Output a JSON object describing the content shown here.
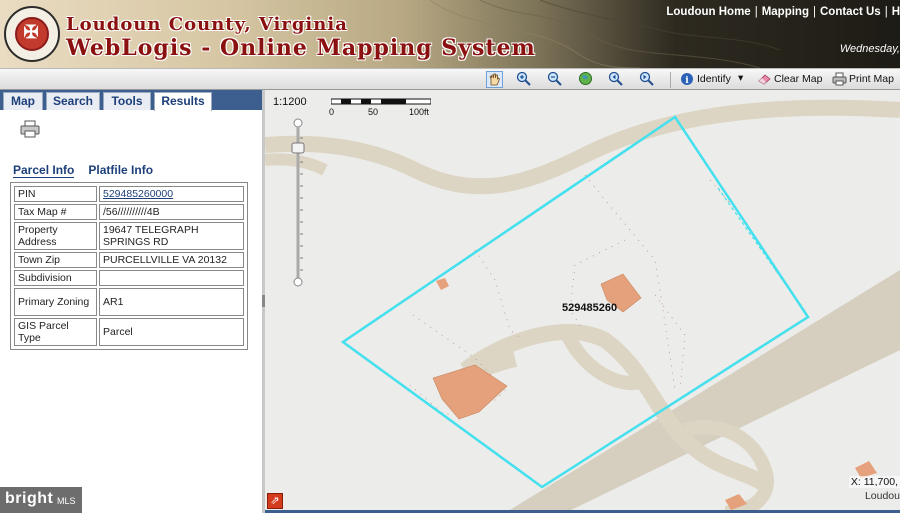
{
  "header": {
    "title_line1": "Loudoun County, Virginia",
    "title_line2": "WebLogis - Online Mapping System",
    "links": [
      "Loudoun Home",
      "Mapping",
      "Contact Us",
      "H"
    ],
    "date_text": "Wednesday, "
  },
  "toolbar": {
    "tools": [
      "pan-icon",
      "zoom-in-icon",
      "zoom-out-icon",
      "full-extent-icon",
      "zoom-previous-icon",
      "zoom-next-icon"
    ],
    "identify_label": "Identify",
    "clear_map_label": "Clear Map",
    "print_map_label": "Print Map"
  },
  "left_panel": {
    "tabs": [
      {
        "label": "Map"
      },
      {
        "label": "Search"
      },
      {
        "label": "Tools"
      },
      {
        "label": "Results",
        "active": true
      }
    ],
    "subtabs": [
      "Parcel Info",
      "Platfile Info"
    ],
    "parcel_rows": [
      {
        "key": "PIN",
        "value": "529485260000",
        "link": true
      },
      {
        "key": "Tax Map #",
        "value": "/56//////////4B"
      },
      {
        "key": "Property Address",
        "value": "19647 TELEGRAPH SPRINGS RD"
      },
      {
        "key": "Town Zip",
        "value": "PURCELLVILLE VA 20132"
      },
      {
        "key": "Subdivision",
        "value": ""
      },
      {
        "key": "Primary Zoning",
        "value": "AR1"
      },
      {
        "key": "GIS Parcel Type",
        "value": "Parcel"
      }
    ]
  },
  "map": {
    "scale_text": "1:1200",
    "scale_labels": [
      "0",
      "50",
      "100ft"
    ],
    "parcel_label": "529485260",
    "coords_text": "X: 11,700,",
    "coords_sub": "Loudou",
    "parcel_color": "#44e0ee",
    "road_color": "#ddd5c3",
    "building_color": "#e5a07c"
  },
  "watermark": {
    "brand": "bright",
    "suffix": "MLS"
  }
}
